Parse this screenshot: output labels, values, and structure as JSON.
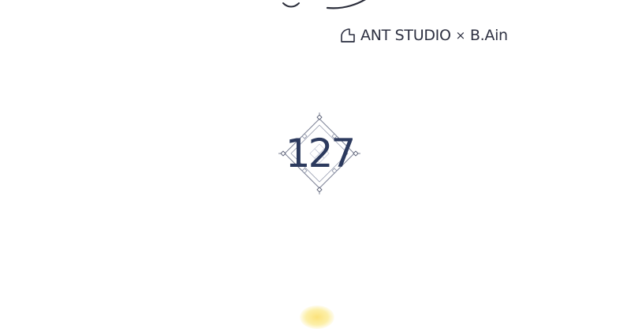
{
  "credit": {
    "studio": "ANT STUDIO",
    "separator": "×",
    "author": "B.Ain",
    "logo_icon": "ant-studio-logo-icon",
    "color": "#2e3142"
  },
  "chapter": {
    "number": "127",
    "ornament_icon": "diamond-frame-icon",
    "color": "#2c3a5e"
  },
  "decor": {
    "top_swash": "swash-ornament",
    "bottom_glow_color": "#fbe27a"
  }
}
